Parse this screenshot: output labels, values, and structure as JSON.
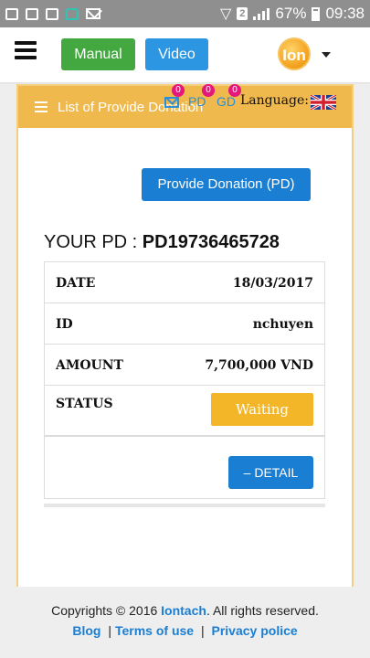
{
  "status_bar": {
    "battery": "67%",
    "time": "09:38",
    "sim": "2"
  },
  "header": {
    "manual_label": "Manual",
    "video_label": "Video",
    "logo_text": "Ion"
  },
  "panel": {
    "title": "List of Provide Donation",
    "mail_count": "0",
    "pd_label": "PD",
    "pd_count": "0",
    "gd_label": "GD",
    "gd_count": "0",
    "language_label": "Language:"
  },
  "main": {
    "provide_button_label": "Provide Donation (PD)",
    "your_pd_label": "YOUR PD : ",
    "pd_code": "PD19736465728",
    "rows": [
      {
        "key": "DATE",
        "value": "18/03/2017"
      },
      {
        "key": "ID",
        "value": "nchuyen"
      },
      {
        "key": "AMOUNT",
        "value": "7,700,000 VND"
      }
    ],
    "status_key": "STATUS",
    "status_value": "Waiting",
    "detail_label": "– DETAIL"
  },
  "footer": {
    "copyright_prefix": "Copyrights © 2016 ",
    "brand": "Iontach",
    "copyright_suffix": ". All rights reserved.",
    "blog": "Blog",
    "terms": "Terms of use",
    "privacy": "Privacy police",
    "separator": "|"
  },
  "colors": {
    "header_gold": "#f0b94e",
    "manual_green": "#43a83f",
    "primary_blue": "#1a7ed3",
    "waiting_amber": "#f4b629",
    "badge_pink": "#e5177b"
  }
}
